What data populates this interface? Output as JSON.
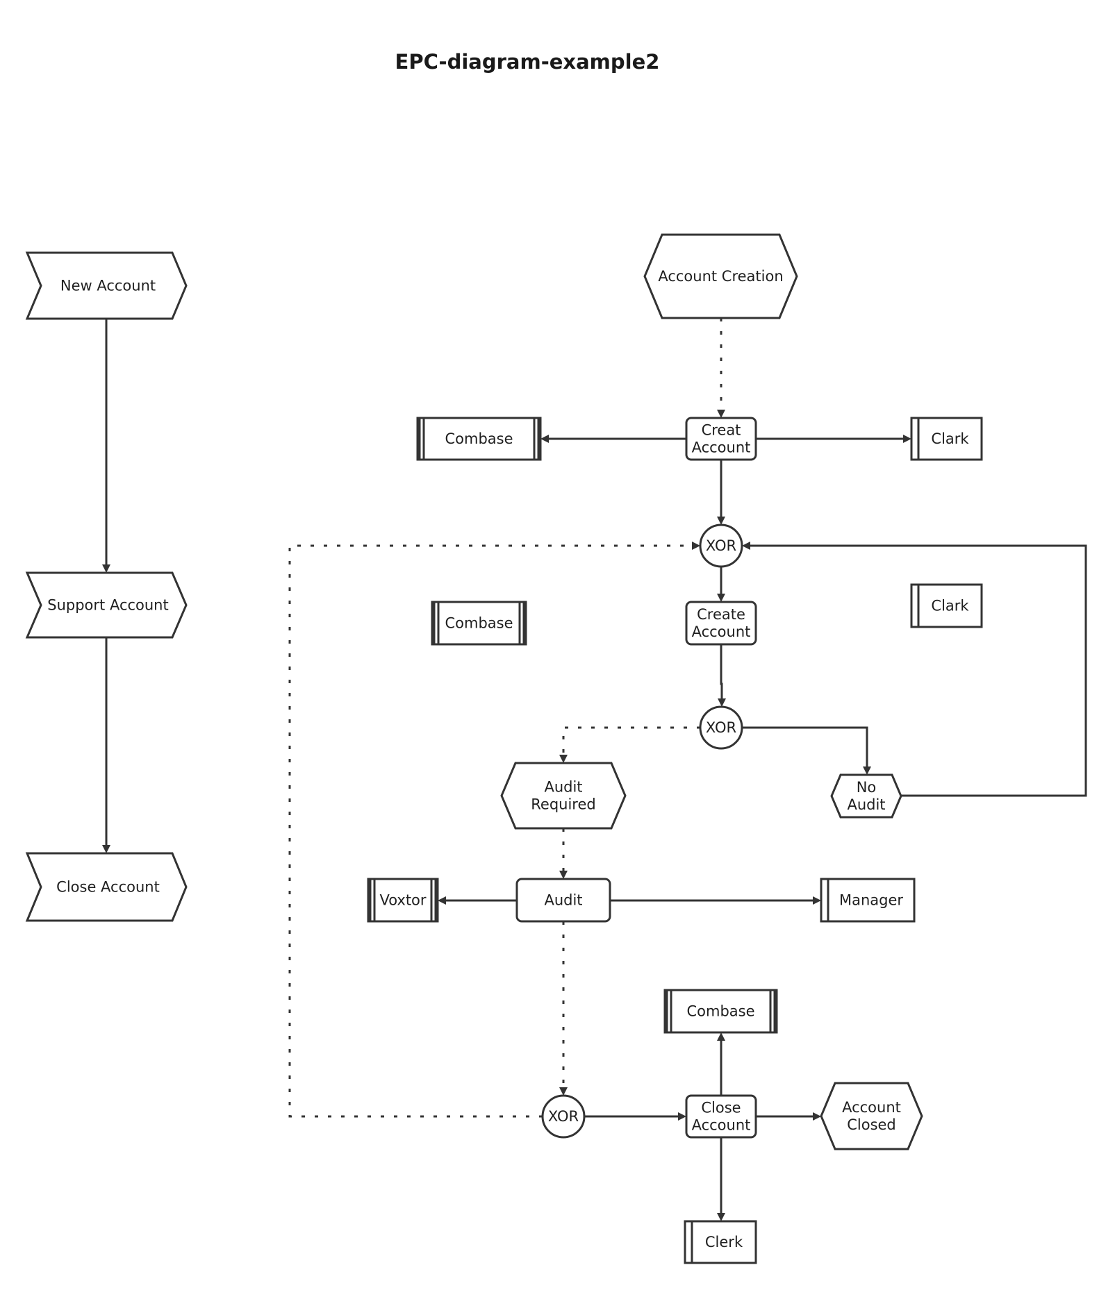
{
  "title": "EPC-diagram-example2",
  "nodes": {
    "new_account": {
      "type": "event-process-step",
      "label": [
        "New Account"
      ]
    },
    "support_account": {
      "type": "event-process-step",
      "label": [
        "Support Account"
      ]
    },
    "close_account_step": {
      "type": "event-process-step",
      "label": [
        "Close Account"
      ]
    },
    "account_creation": {
      "type": "event",
      "label": [
        "Account Creation"
      ]
    },
    "combase_1": {
      "type": "information-system",
      "label": [
        "Combase"
      ]
    },
    "creat_account": {
      "type": "function",
      "label": [
        "Creat",
        "Account"
      ]
    },
    "clark_1": {
      "type": "organization-unit",
      "label": [
        "Clark"
      ]
    },
    "xor_1": {
      "type": "xor-connector",
      "label": [
        "XOR"
      ]
    },
    "combase_2": {
      "type": "information-system",
      "label": [
        "Combase"
      ]
    },
    "create_account": {
      "type": "function",
      "label": [
        "Create",
        "Account"
      ]
    },
    "clark_2": {
      "type": "organization-unit",
      "label": [
        "Clark"
      ]
    },
    "xor_2": {
      "type": "xor-connector",
      "label": [
        "XOR"
      ]
    },
    "audit_required": {
      "type": "event",
      "label": [
        "Audit",
        "Required"
      ]
    },
    "no_audit": {
      "type": "event",
      "label": [
        "No",
        "Audit"
      ]
    },
    "voxtor": {
      "type": "information-system",
      "label": [
        "Voxtor"
      ]
    },
    "audit": {
      "type": "function",
      "label": [
        "Audit"
      ]
    },
    "manager": {
      "type": "organization-unit",
      "label": [
        "Manager"
      ]
    },
    "combase_3": {
      "type": "information-system",
      "label": [
        "Combase"
      ]
    },
    "xor_3": {
      "type": "xor-connector",
      "label": [
        "XOR"
      ]
    },
    "close_account_fn": {
      "type": "function",
      "label": [
        "Close",
        "Account"
      ]
    },
    "account_closed": {
      "type": "event",
      "label": [
        "Account",
        "Closed"
      ]
    },
    "clerk": {
      "type": "organization-unit",
      "label": [
        "Clerk"
      ]
    }
  },
  "edges": [
    {
      "from": "new_account",
      "to": "support_account",
      "style": "solid"
    },
    {
      "from": "support_account",
      "to": "close_account_step",
      "style": "solid"
    },
    {
      "from": "account_creation",
      "to": "creat_account",
      "style": "dotted"
    },
    {
      "from": "creat_account",
      "to": "combase_1",
      "style": "solid"
    },
    {
      "from": "creat_account",
      "to": "clark_1",
      "style": "solid"
    },
    {
      "from": "creat_account",
      "to": "xor_1",
      "style": "solid"
    },
    {
      "from": "xor_1",
      "to": "create_account",
      "style": "solid"
    },
    {
      "from": "create_account",
      "to": "xor_2",
      "style": "solid"
    },
    {
      "from": "xor_2",
      "to": "audit_required",
      "style": "dotted"
    },
    {
      "from": "xor_2",
      "to": "no_audit",
      "style": "solid"
    },
    {
      "from": "no_audit",
      "to": "xor_1",
      "style": "solid"
    },
    {
      "from": "audit_required",
      "to": "audit",
      "style": "dotted"
    },
    {
      "from": "audit",
      "to": "voxtor",
      "style": "solid"
    },
    {
      "from": "audit",
      "to": "manager",
      "style": "solid"
    },
    {
      "from": "audit",
      "to": "xor_3",
      "style": "dotted"
    },
    {
      "from": "xor_3",
      "to": "xor_1",
      "style": "dotted"
    },
    {
      "from": "xor_3",
      "to": "close_account_fn",
      "style": "solid"
    },
    {
      "from": "close_account_fn",
      "to": "combase_3",
      "style": "solid"
    },
    {
      "from": "close_account_fn",
      "to": "account_closed",
      "style": "solid"
    },
    {
      "from": "close_account_fn",
      "to": "clerk",
      "style": "solid"
    }
  ]
}
